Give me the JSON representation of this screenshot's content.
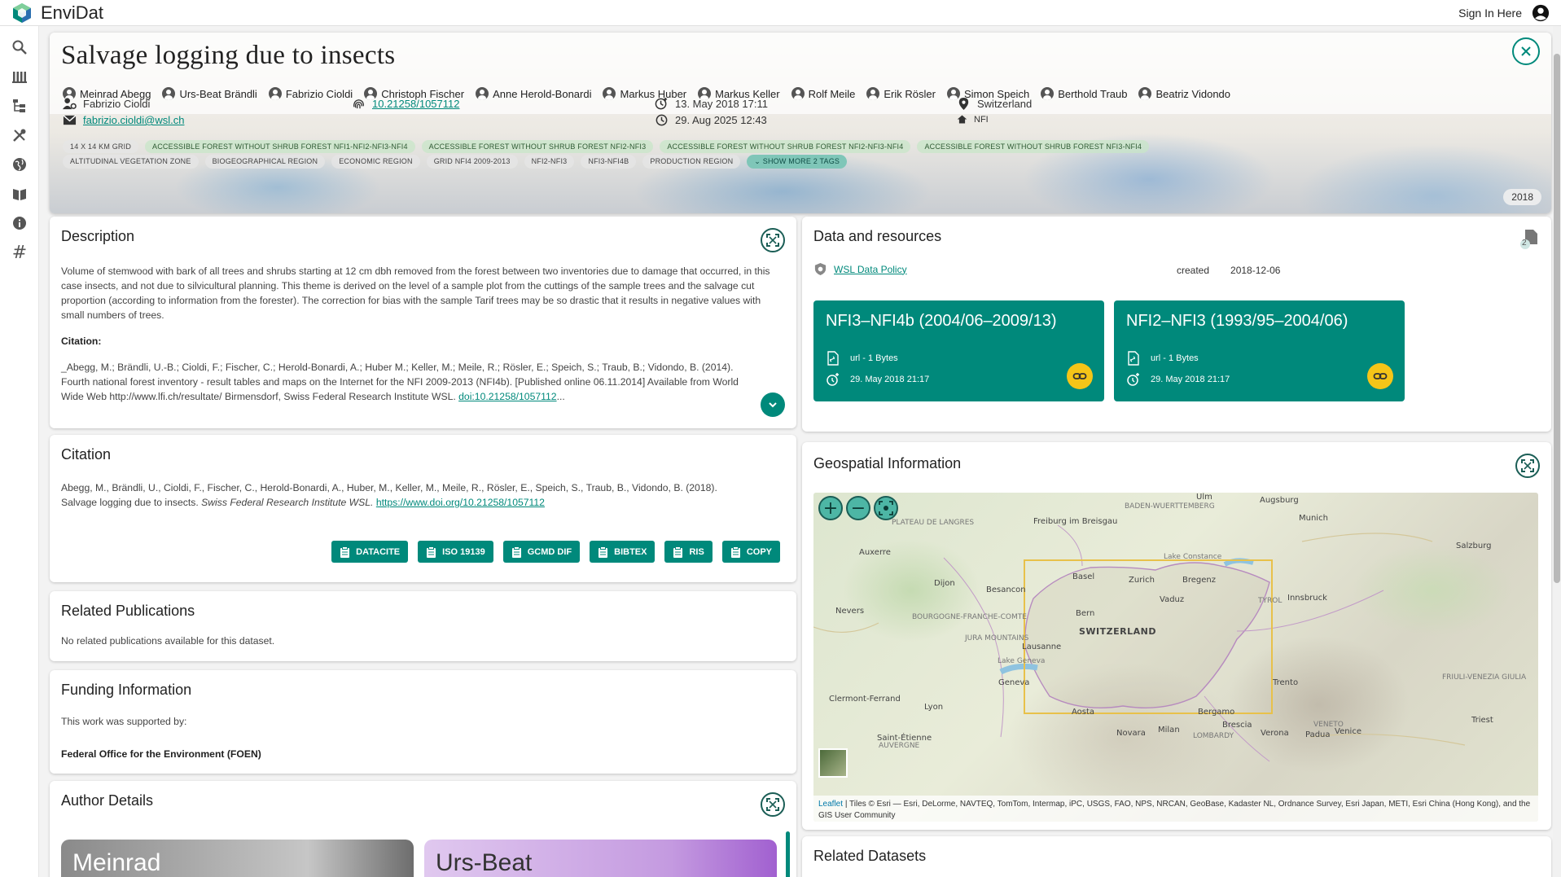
{
  "app": {
    "name": "EnviDat",
    "sign_in": "Sign In Here"
  },
  "nav": [
    "search-icon",
    "browse-icon",
    "projects-icon",
    "tools-icon",
    "map-icon",
    "guides-icon",
    "about-icon",
    "hashtag-icon"
  ],
  "nav_hash_glyph": "#",
  "dataset": {
    "title": "Salvage logging due to insects",
    "authors": [
      "Meinrad Abegg",
      "Urs-Beat Brändli",
      "Fabrizio Cioldi",
      "Christoph Fischer",
      "Anne Herold-Bonardi",
      "Markus Huber",
      "Markus Keller",
      "Rolf Meile",
      "Erik Rösler",
      "Simon Speich",
      "Berthold Traub",
      "Beatriz Vidondo"
    ],
    "contact_name": "Fabrizio Cioldi",
    "contact_email": "fabrizio.cioldi@wsl.ch",
    "doi": "10.21258/1057112",
    "created": "13. May 2018 17:11",
    "modified": "29. Aug 2025 12:43",
    "location": "Switzerland",
    "organization": "NFI",
    "year": "2018",
    "tags_row1": [
      "14 X 14 KM GRID",
      "ACCESSIBLE FOREST WITHOUT SHRUB FOREST NFI1-NFI2-NFI3-NFI4",
      "ACCESSIBLE FOREST WITHOUT SHRUB FOREST NFI2-NFI3",
      "ACCESSIBLE FOREST WITHOUT SHRUB FOREST NFI2-NFI3-NFI4",
      "ACCESSIBLE FOREST WITHOUT SHRUB FOREST NFI3-NFI4"
    ],
    "tags_row2": [
      "ALTITUDINAL VEGETATION ZONE",
      "BIOGEOGRAPHICAL REGION",
      "ECONOMIC REGION",
      "GRID NFI4 2009-2013",
      "NFI2-NFI3",
      "NFI3-NFI4B",
      "PRODUCTION REGION"
    ],
    "show_more_tags": "SHOW MORE 2 TAGS"
  },
  "description": {
    "title": "Description",
    "text": "Volume of stemwood with bark of all trees and shrubs starting at 12 cm dbh removed from the forest between two inventories due to damage that occurred, in this case insects, and not due to silvicultural planning. This theme is derived on the level of a sample plot from the cuttings of the sample trees and the salvage cut proportion (according to information from the forester). The correction for bias with the sample Tarif trees may be so drastic that it results in negative values with small numbers of trees.",
    "citation_label": "Citation:",
    "citation_text": "_Abegg, M.; Brändli, U.-B.; Cioldi, F.; Fischer, C.; Herold-Bonardi, A.; Huber M.; Keller, M.; Meile, R.; Rösler, E.; Speich, S.; Traub, B.; Vidondo, B. (2014). Fourth national forest inventory - result tables and maps on the Internet for the NFI 2009-2013 (NFI4b). [Published online 06.11.2014] Available from World Wide Web http://www.lfi.ch/resultate/ Birmensdorf, Swiss Federal Research Institute WSL.",
    "citation_link": "doi:10.21258/1057112",
    "ellipsis": "..."
  },
  "citation": {
    "title": "Citation",
    "text": "Abegg, M., Brändli, U., Cioldi, F., Fischer, C., Herold-Bonardi, A., Huber, M., Keller, M., Meile, R., Rösler, E., Speich, S., Traub, B., Vidondo, B. (2018).",
    "text2": "Salvage logging due to insects.",
    "publisher": "Swiss Federal Research Institute WSL.",
    "link": "https://www.doi.org/10.21258/1057112",
    "buttons": [
      "DATACITE",
      "ISO 19139",
      "GCMD DIF",
      "BIBTEX",
      "RIS",
      "COPY"
    ]
  },
  "related_publications": {
    "title": "Related Publications",
    "text": "No related publications available for this dataset."
  },
  "funding": {
    "title": "Funding Information",
    "text": "This work was supported by:",
    "funder": "Federal Office for the Environment (FOEN)"
  },
  "author_details": {
    "title": "Author Details",
    "cards": [
      "Meinrad",
      "Urs-Beat"
    ]
  },
  "resources": {
    "title": "Data and resources",
    "count": "2",
    "policy": "WSL Data Policy",
    "created_label": "created",
    "created_value": "2018-12-06",
    "items": [
      {
        "name": "NFI3–NFI4b (2004/06–2009/13)",
        "type": "url - 1 Bytes",
        "date": "29. May 2018 21:17"
      },
      {
        "name": "NFI2–NFI3 (1993/95–2004/06)",
        "type": "url - 1 Bytes",
        "date": "29. May 2018 21:17"
      }
    ]
  },
  "geo": {
    "title": "Geospatial Information",
    "zoom_in": "+",
    "zoom_out": "−",
    "labels": {
      "ulm": "Ulm",
      "augsburg": "Augsburg",
      "munich": "Munich",
      "salzburg": "Salzburg",
      "freiburg": "Freiburg im Breisgau",
      "auxerre": "Auxerre",
      "dijon": "Dijon",
      "besancon": "Besancon",
      "basel": "Basel",
      "zurich": "Zurich",
      "bregenz": "Bregenz",
      "vaduz": "Vaduz",
      "innsbruck": "Innsbruck",
      "nevers": "Nevers",
      "bern": "Bern",
      "switzerland": "SWITZERLAND",
      "lausanne": "Lausanne",
      "geneva": "Geneva",
      "trento": "Trento",
      "lyon": "Lyon",
      "aosta": "Aosta",
      "bergamo": "Bergamo",
      "brescia": "Brescia",
      "novara": "Novara",
      "milan": "Milan",
      "verona": "Verona",
      "padua": "Padua",
      "venice": "Venice",
      "trieste": "Triest",
      "clermont": "Clermont-Ferrand",
      "saint_etienne": "Saint-Étienne",
      "plateau": "PLATEAU DE LANGRES",
      "bourgogne": "BOURGOGNE-FRANCHE-COMTE",
      "tyrol": "TYROL",
      "baden": "BADEN-WUERTTEMBERG",
      "jura": "JURA MOUNTAINS",
      "lombardy": "LOMBARDY",
      "veneto": "VENETO",
      "friuli": "FRIULI-VENEZIA GIULIA",
      "auvergne": "AUVERGNE",
      "lake_constance": "Lake Constance",
      "lake_geneva": "Lake Geneva"
    },
    "attribution_leaflet": "Leaflet",
    "attribution": "| Tiles © Esri — Esri, DeLorme, NAVTEQ, TomTom, Intermap, iPC, USGS, FAO, NPS, NRCAN, GeoBase, Kadaster NL, Ordnance Survey, Esri Japan, METI, Esri China (Hong Kong), and the GIS User Community"
  },
  "related_datasets": {
    "title": "Related Datasets"
  },
  "colors": {
    "accent": "#00897b",
    "link_badge": "#f5c518"
  }
}
